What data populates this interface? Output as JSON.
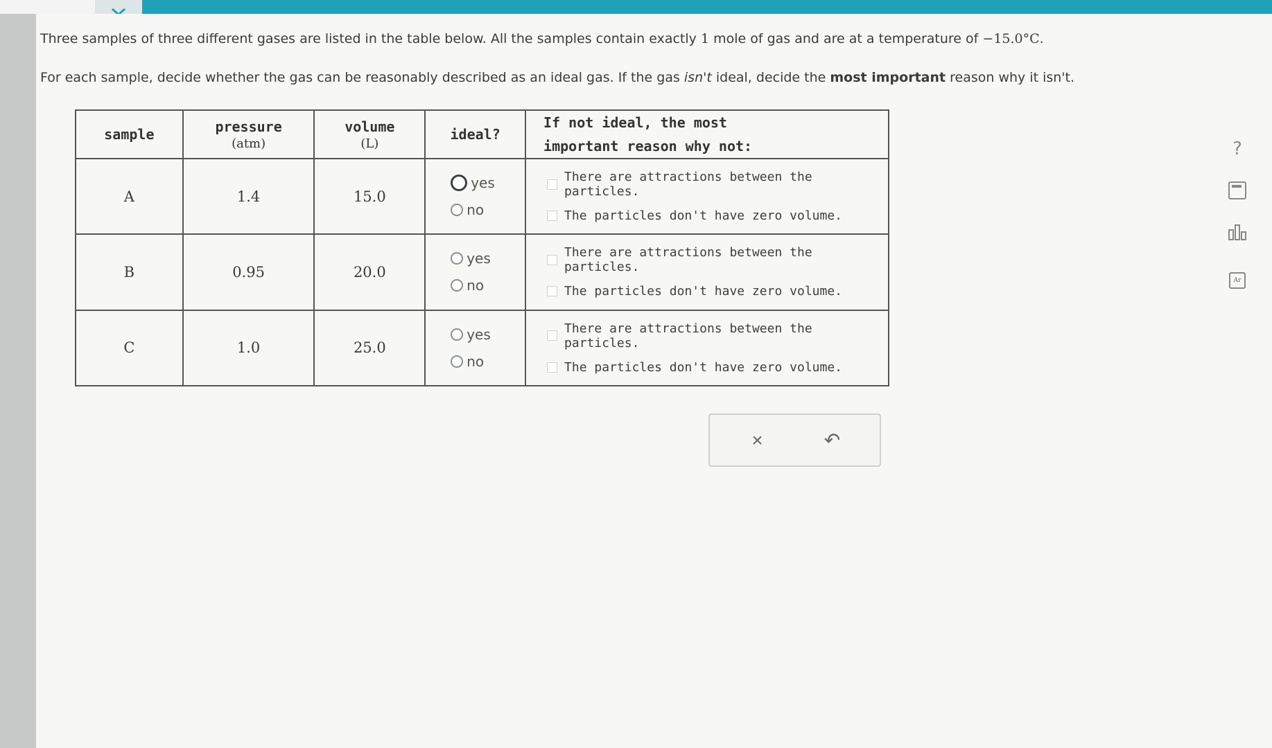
{
  "prompt": {
    "line1_a": "Three samples of three different gases are listed in the table below. All the samples contain exactly ",
    "line1_mole_count": "1",
    "line1_b": " mole of gas and are at a temperature of ",
    "line1_temperature": "−15.0°C",
    "line1_c": ".",
    "line2_a": "For each sample, decide whether the gas can be reasonably described as an ideal gas. If the gas ",
    "line2_italic": "isn't",
    "line2_b": " ideal, decide the ",
    "line2_bold": "most important",
    "line2_c": " reason why it isn't."
  },
  "table": {
    "headers": {
      "sample": "sample",
      "pressure": "pressure",
      "pressure_unit": "(atm)",
      "volume": "volume",
      "volume_unit": "(L)",
      "ideal": "ideal?",
      "reason_line1": "If not ideal, the most",
      "reason_line2": "important reason why not:"
    },
    "rows": [
      {
        "sample": "A",
        "pressure": "1.4",
        "volume": "15.0",
        "yes": "yes",
        "no": "no",
        "reason1": "There are attractions between the particles.",
        "reason2": "The particles don't have zero volume."
      },
      {
        "sample": "B",
        "pressure": "0.95",
        "volume": "20.0",
        "yes": "yes",
        "no": "no",
        "reason1": "There are attractions between the particles.",
        "reason2": "The particles don't have zero volume."
      },
      {
        "sample": "C",
        "pressure": "1.0",
        "volume": "25.0",
        "yes": "yes",
        "no": "no",
        "reason1": "There are attractions between the particles.",
        "reason2": "The particles don't have zero volume."
      }
    ]
  },
  "actions": {
    "clear": "×",
    "undo": "↶"
  },
  "tools": {
    "help": "?",
    "periodic": "Ar"
  },
  "icons": [
    "chevron-down-icon",
    "close-icon",
    "undo-icon",
    "help-icon",
    "calculator-icon",
    "bar-chart-icon",
    "periodic-table-icon"
  ],
  "colors": {
    "top_bar": "#1fa2b8",
    "background": "#f7f7f6",
    "text": "#3b3b3b"
  }
}
